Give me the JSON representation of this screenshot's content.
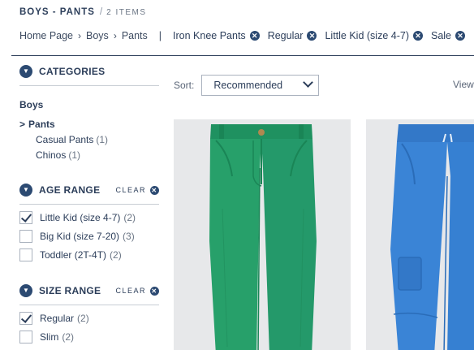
{
  "header": {
    "title": "BOYS - PANTS",
    "separator": "/",
    "item_count": "2 ITEMS"
  },
  "breadcrumb": {
    "crumbs": [
      "Home Page",
      "Boys",
      "Pants"
    ],
    "filters": [
      "Iron Knee Pants",
      "Regular",
      "Little Kid (size 4-7)",
      "Sale"
    ]
  },
  "sidebar": {
    "categories": {
      "title": "CATEGORIES",
      "root": "Boys",
      "current": "Pants",
      "current_marker": ">",
      "subs": [
        {
          "label": "Casual Pants",
          "count": "(1)"
        },
        {
          "label": "Chinos",
          "count": "(1)"
        }
      ]
    },
    "age_range": {
      "title": "AGE RANGE",
      "clear": "CLEAR",
      "options": [
        {
          "label": "Little Kid (size 4-7)",
          "count": "(2)",
          "checked": true
        },
        {
          "label": "Big Kid (size 7-20)",
          "count": "(3)",
          "checked": false
        },
        {
          "label": "Toddler (2T-4T)",
          "count": "(2)",
          "checked": false
        }
      ]
    },
    "size_range": {
      "title": "SIZE RANGE",
      "clear": "CLEAR",
      "options": [
        {
          "label": "Regular",
          "count": "(2)",
          "checked": true
        },
        {
          "label": "Slim",
          "count": "(2)",
          "checked": false
        }
      ]
    }
  },
  "toolbar": {
    "sort_label": "Sort:",
    "sort_value": "Recommended",
    "view_label": "View"
  },
  "colors": {
    "navy": "#2c4a72",
    "green_pants": "#27a06a",
    "blue_pants": "#3a84d6"
  },
  "products": [
    {
      "image": "green-pants-image"
    },
    {
      "image": "blue-pants-image"
    }
  ]
}
